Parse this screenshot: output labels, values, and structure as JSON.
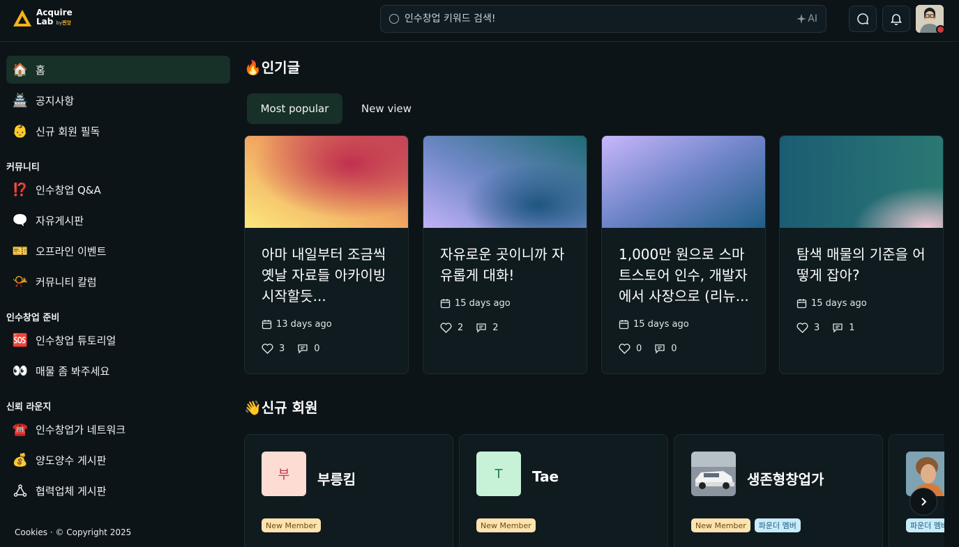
{
  "header": {
    "logo_line1": "Acquire",
    "logo_line2": "Lab",
    "logo_by": "by",
    "logo_brand": "찐앙",
    "search_placeholder": "인수창업 키워드 검색!",
    "ai_label": "AI",
    "icons": [
      "chat-icon",
      "bell-icon"
    ]
  },
  "sidebar": {
    "top_items": [
      {
        "label": "홈",
        "emoji": "🏠",
        "active": true
      },
      {
        "label": "공지사항",
        "emoji": "🏯"
      },
      {
        "label": "신규 회원 필독",
        "emoji": "👶"
      }
    ],
    "sections": [
      {
        "title": "커뮤니티",
        "items": [
          {
            "label": "인수창업 Q&A",
            "emoji": "⁉️"
          },
          {
            "label": "자유게시판",
            "emoji": "🗨️"
          },
          {
            "label": "오프라인 이벤트",
            "emoji": "🎫"
          },
          {
            "label": "커뮤니티 칼럼",
            "emoji": "📯"
          }
        ]
      },
      {
        "title": "인수창업 준비",
        "items": [
          {
            "label": "인수창업 튜토리얼",
            "emoji": "🆘"
          },
          {
            "label": "매물 좀 봐주세요",
            "emoji": "👀"
          }
        ]
      },
      {
        "title": "신뢰 라운지",
        "items": [
          {
            "label": "인수창업가 네트워크",
            "emoji": "☎️"
          },
          {
            "label": "양도양수 게시판",
            "emoji": "💰"
          },
          {
            "label": "협력업체 게시판",
            "emoji": "share"
          }
        ]
      }
    ],
    "footer": "Cookies · © Copyright 2025"
  },
  "popular": {
    "title": "🔥인기글",
    "tabs": [
      "Most popular",
      "New view"
    ],
    "posts": [
      {
        "title": "아마 내일부터 조금씩 옛날 자료들 아카이빙 시작할듯...",
        "date": "13 days ago",
        "likes": "3",
        "comments": "0"
      },
      {
        "title": "자유로운 곳이니까 자유롭게 대화!",
        "date": "15 days ago",
        "likes": "2",
        "comments": "2"
      },
      {
        "title": "1,000만 원으로 스마트스토어 인수, 개발자에서 사장으로 (리뉴...",
        "date": "15 days ago",
        "likes": "0",
        "comments": "0"
      },
      {
        "title": "탐색 매물의 기준을 어떻게 잡아?",
        "date": "15 days ago",
        "likes": "3",
        "comments": "1"
      }
    ]
  },
  "members": {
    "title": "👋신규 회원",
    "list": [
      {
        "name": "부릉킴",
        "initial": "부",
        "badges": [
          "New Member"
        ]
      },
      {
        "name": "Tae",
        "initial": "T",
        "badges": [
          "New Member"
        ]
      },
      {
        "name": "생존형창업가",
        "initial": "",
        "badges": [
          "New Member",
          "파운더 멤버"
        ]
      },
      {
        "name": "",
        "initial": "",
        "badges": [
          "파운더 멤버"
        ]
      }
    ]
  }
}
